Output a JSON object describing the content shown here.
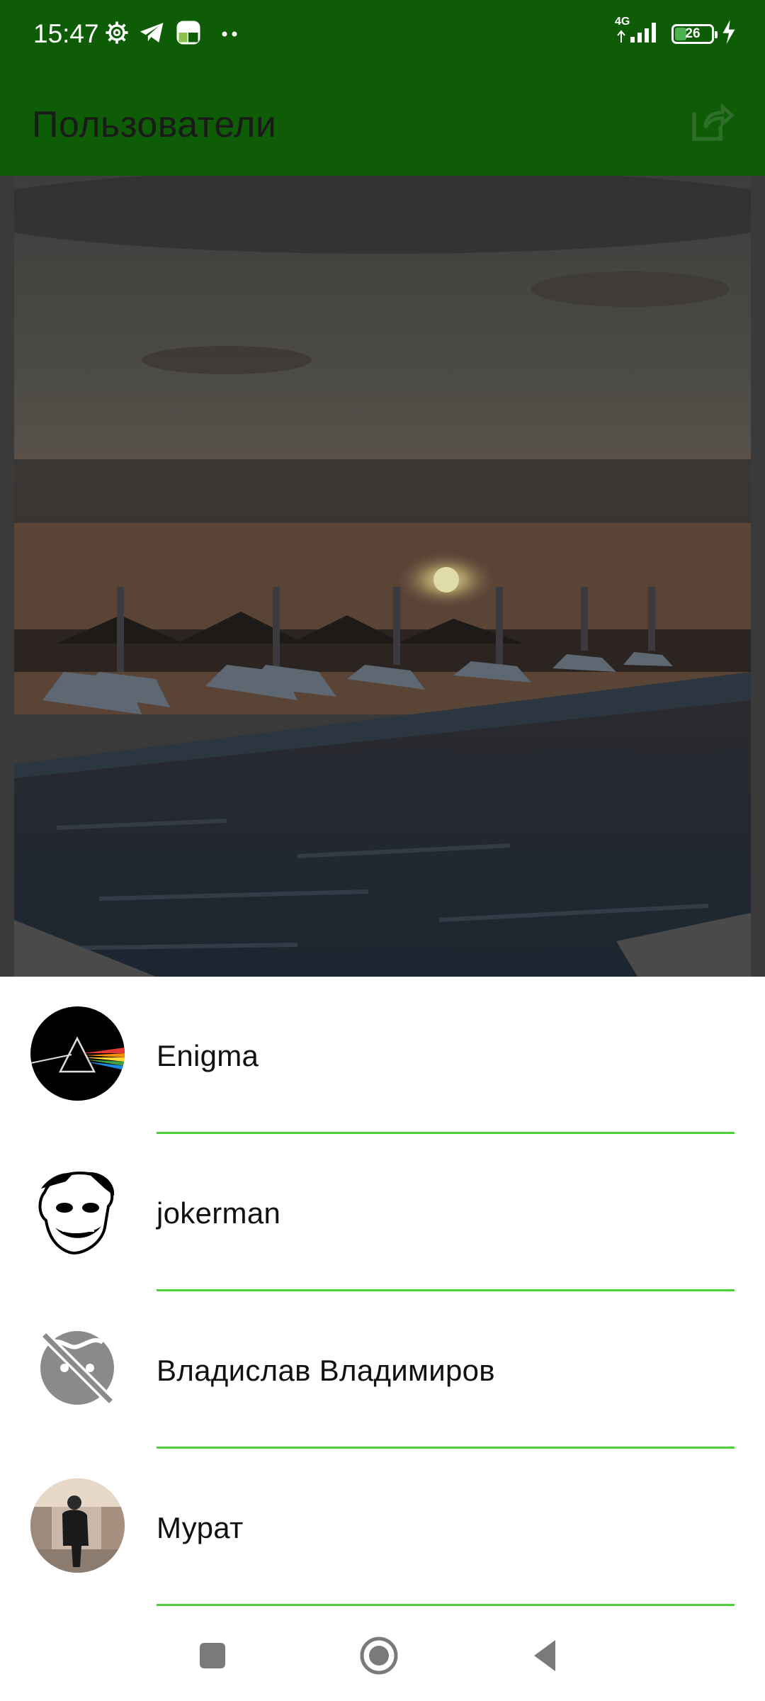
{
  "status": {
    "time": "15:47",
    "network": "4G",
    "battery": "26",
    "left_icons": [
      "settings-gear-icon",
      "telegram-icon",
      "app-icon",
      "more-dots-icon"
    ],
    "right_icons": [
      "signal-icon",
      "battery-icon",
      "charging-icon"
    ]
  },
  "appbar": {
    "title": "Пользователи",
    "action_icon": "share-icon",
    "background": "#0f5c07"
  },
  "users": [
    {
      "name": "Enigma",
      "avatar": "prism-avatar"
    },
    {
      "name": "jokerman",
      "avatar": "joker-avatar"
    },
    {
      "name": "Владислав Владимиров",
      "avatar": "no-avatar-icon"
    },
    {
      "name": "Мурат",
      "avatar": "photo-avatar"
    }
  ],
  "colors": {
    "divider": "#4cd137",
    "accent": "#0f5c07"
  },
  "navbar": {
    "icons": [
      "recents-square-icon",
      "home-circle-icon",
      "back-triangle-icon"
    ]
  }
}
